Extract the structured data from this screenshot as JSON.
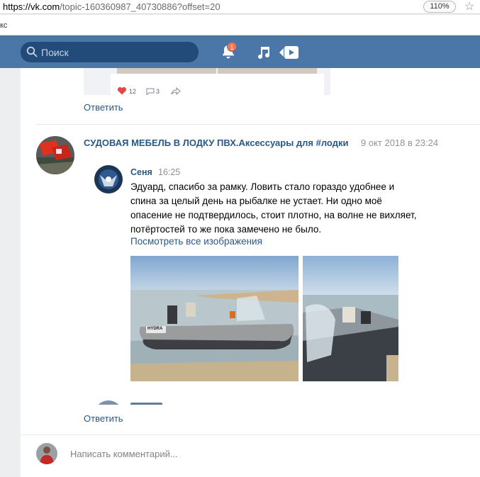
{
  "browser": {
    "url_host": "https://vk.com",
    "url_path": "/topic-160360987_40730886?offset=20",
    "zoom": "110%",
    "bookmark_fragment": "кс"
  },
  "header": {
    "search_placeholder": "Поиск",
    "notifications_count": "1",
    "colors": {
      "bar": "#4a76a8",
      "search_bg": "#224b7a",
      "badge": "#ff734c"
    }
  },
  "previous_post": {
    "likes": "12",
    "comments": "3",
    "reply_label": "Ответить"
  },
  "post": {
    "title": "СУДОВАЯ МЕБЕЛЬ В ЛОДКУ ПВХ.Аксессуары для #лодки",
    "date": "9 окт 2018 в 23:24",
    "comment": {
      "author": "Сеня",
      "time": "16:25",
      "text": "Эдуард, спасибо за рамку. Ловить стало гораздо удобнее и спина за целый день на рыбалке не устает. Ни одно моё опасение не подтвердилось, стоит плотно, на волне не вихляет, потёртостей то же пока замечено не было.",
      "see_all_label": "Посмотреть все изображения",
      "photo_text": "HYDRA"
    },
    "reply_label": "Ответить"
  },
  "composer": {
    "placeholder": "Написать комментарий..."
  }
}
